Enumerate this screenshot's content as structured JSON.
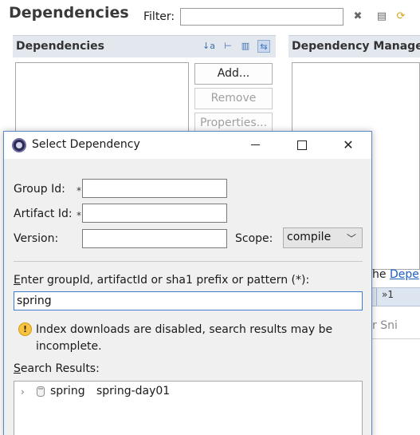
{
  "background": {
    "title": "Dependencies",
    "filter_label": "Filter:",
    "filter_value": "",
    "dependencies_header": "Dependencies",
    "dependency_management_header": "Dependency Manage",
    "buttons": {
      "add": "Add...",
      "remove": "Remove",
      "properties": "Properties..."
    },
    "right_text_prefix": "he",
    "right_text_link": "Depe",
    "right_bar_text": "»1",
    "bottom_tabs_text": "r  Sni"
  },
  "dialog": {
    "title": "Select Dependency",
    "fields": {
      "group_id_label": "Group Id:",
      "group_id_value": "",
      "artifact_id_label": "Artifact Id:",
      "artifact_id_value": "",
      "version_label": "Version:",
      "version_value": "",
      "scope_label": "Scope:",
      "scope_value": "compile",
      "required_marker": "*"
    },
    "search": {
      "label_prefix": "",
      "label_mnemonic": "E",
      "label_rest": "nter groupId, artifactId or sha1 prefix or pattern (*):",
      "value": "spring"
    },
    "warning": "Index downloads are disabled, search results may be incomplete.",
    "results": {
      "label_mnemonic": "S",
      "label_rest": "earch Results:",
      "items": [
        {
          "group": "spring",
          "artifact": "spring-day01"
        }
      ]
    }
  }
}
